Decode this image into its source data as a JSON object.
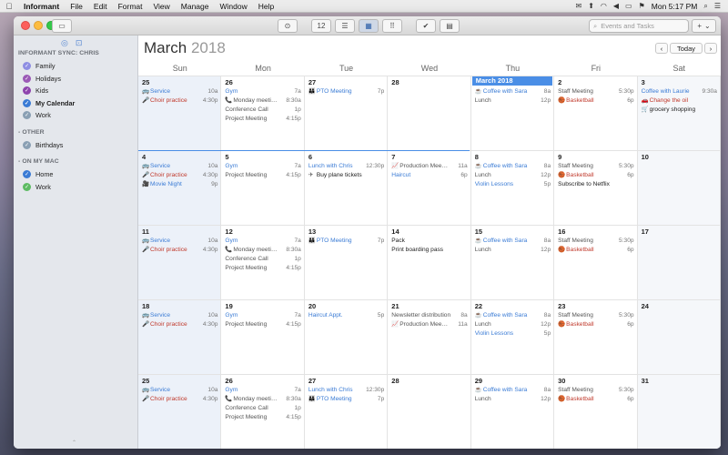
{
  "menubar": {
    "app": "Informant",
    "items": [
      "File",
      "Edit",
      "Format",
      "View",
      "Manage",
      "Window",
      "Help"
    ],
    "clock": "Mon 5:17 PM"
  },
  "toolbar": {
    "search_placeholder": "Events and Tasks",
    "calendar_day_label": "12"
  },
  "sidebar": {
    "sections": [
      {
        "title": "INFORMANT SYNC: CHRIS",
        "items": [
          {
            "label": "Family",
            "color": "#8e8ee3"
          },
          {
            "label": "Holidays",
            "color": "#9b59b6"
          },
          {
            "label": "Kids",
            "color": "#8e44ad"
          },
          {
            "label": "My Calendar",
            "color": "#3a7bd5",
            "bold": true
          },
          {
            "label": "Work",
            "color": "#8aa0b4"
          }
        ]
      },
      {
        "title": "- OTHER",
        "items": [
          {
            "label": "Birthdays",
            "color": "#8aa0b4"
          }
        ]
      },
      {
        "title": "- ON MY MAC",
        "items": [
          {
            "label": "Home",
            "color": "#3a7bd5"
          },
          {
            "label": "Work",
            "color": "#5dbb63"
          }
        ]
      }
    ]
  },
  "calendar": {
    "month": "March",
    "year": "2018",
    "today_label": "Today",
    "banner": "March 2018",
    "days_of_week": [
      "Sun",
      "Mon",
      "Tue",
      "Wed",
      "Thu",
      "Fri",
      "Sat"
    ],
    "weeks": [
      [
        {
          "day": "25",
          "events": [
            {
              "icon": "🚌",
              "name": "Service",
              "time": "10a",
              "style": "blue"
            },
            {
              "icon": "🎤",
              "name": "Choir practice",
              "time": "4:30p",
              "style": "red"
            }
          ]
        },
        {
          "day": "26",
          "events": [
            {
              "name": "Gym",
              "time": "7a",
              "style": "blue"
            },
            {
              "icon": "📞",
              "name": "Monday meeti…",
              "time": "8:30a",
              "style": "plain"
            },
            {
              "name": "Conference Call",
              "time": "1p",
              "style": "plain"
            },
            {
              "name": "Project Meeting",
              "time": "4:15p",
              "style": "plain"
            }
          ]
        },
        {
          "day": "27",
          "events": [
            {
              "icon": "👪",
              "name": "PTO Meeting",
              "time": "7p",
              "style": "blue"
            }
          ]
        },
        {
          "day": "28",
          "events": []
        },
        {
          "day": "1",
          "events": [
            {
              "icon": "☕",
              "name": "Coffee with Sara",
              "time": "8a",
              "style": "blue"
            },
            {
              "name": "Lunch",
              "time": "12p",
              "style": "plain"
            }
          ]
        },
        {
          "day": "2",
          "events": [
            {
              "name": "Staff Meeting",
              "time": "5:30p",
              "style": "plain"
            },
            {
              "icon": "🏀",
              "name": "Basketball",
              "time": "6p",
              "style": "red"
            }
          ]
        },
        {
          "day": "3",
          "events": [
            {
              "name": "Coffee with Laurie",
              "time": "9:30a",
              "style": "blue"
            },
            {
              "icon": "🚗",
              "name": "Change the oil",
              "time": "",
              "style": "red"
            },
            {
              "icon": "🛒",
              "name": "grocery shopping",
              "time": "",
              "style": "dark"
            }
          ]
        }
      ],
      [
        {
          "day": "4",
          "events": [
            {
              "icon": "🚌",
              "name": "Service",
              "time": "10a",
              "style": "blue"
            },
            {
              "icon": "🎤",
              "name": "Choir practice",
              "time": "4:30p",
              "style": "red"
            },
            {
              "icon": "🎥",
              "name": "Movie Night",
              "time": "9p",
              "style": "blue"
            }
          ]
        },
        {
          "day": "5",
          "events": [
            {
              "name": "Gym",
              "time": "7a",
              "style": "blue"
            },
            {
              "name": "Project Meeting",
              "time": "4:15p",
              "style": "plain"
            }
          ]
        },
        {
          "day": "6",
          "events": [
            {
              "name": "Lunch with Chris",
              "time": "12:30p",
              "style": "blue"
            },
            {
              "icon": "✈",
              "name": "Buy plane tickets",
              "time": "",
              "style": "dark"
            }
          ]
        },
        {
          "day": "7",
          "events": [
            {
              "icon": "📈",
              "name": "Production Mee…",
              "time": "11a",
              "style": "plain"
            },
            {
              "name": "Haircut",
              "time": "6p",
              "style": "blue"
            }
          ]
        },
        {
          "day": "8",
          "events": [
            {
              "icon": "☕",
              "name": "Coffee with Sara",
              "time": "8a",
              "style": "blue"
            },
            {
              "name": "Lunch",
              "time": "12p",
              "style": "plain"
            },
            {
              "name": "Violin Lessons",
              "time": "5p",
              "style": "blue"
            }
          ]
        },
        {
          "day": "9",
          "events": [
            {
              "name": "Staff Meeting",
              "time": "5:30p",
              "style": "plain"
            },
            {
              "icon": "🏀",
              "name": "Basketball",
              "time": "6p",
              "style": "red"
            },
            {
              "name": "Subscribe to Netflix",
              "time": "",
              "style": "dark"
            }
          ]
        },
        {
          "day": "10",
          "events": []
        }
      ],
      [
        {
          "day": "11",
          "events": [
            {
              "icon": "🚌",
              "name": "Service",
              "time": "10a",
              "style": "blue"
            },
            {
              "icon": "🎤",
              "name": "Choir practice",
              "time": "4:30p",
              "style": "red"
            }
          ]
        },
        {
          "day": "12",
          "events": [
            {
              "name": "Gym",
              "time": "7a",
              "style": "blue"
            },
            {
              "icon": "📞",
              "name": "Monday meeti…",
              "time": "8:30a",
              "style": "plain"
            },
            {
              "name": "Conference Call",
              "time": "1p",
              "style": "plain"
            },
            {
              "name": "Project Meeting",
              "time": "4:15p",
              "style": "plain"
            }
          ]
        },
        {
          "day": "13",
          "events": [
            {
              "icon": "👪",
              "name": "PTO Meeting",
              "time": "7p",
              "style": "blue"
            }
          ]
        },
        {
          "day": "14",
          "events": [
            {
              "name": "Pack",
              "time": "",
              "style": "dark"
            },
            {
              "name": "Print boarding pass",
              "time": "",
              "style": "dark"
            }
          ]
        },
        {
          "day": "15",
          "events": [
            {
              "icon": "☕",
              "name": "Coffee with Sara",
              "time": "8a",
              "style": "blue"
            },
            {
              "name": "Lunch",
              "time": "12p",
              "style": "plain"
            }
          ]
        },
        {
          "day": "16",
          "events": [
            {
              "name": "Staff Meeting",
              "time": "5:30p",
              "style": "plain"
            },
            {
              "icon": "🏀",
              "name": "Basketball",
              "time": "6p",
              "style": "red"
            }
          ]
        },
        {
          "day": "17",
          "events": []
        }
      ],
      [
        {
          "day": "18",
          "events": [
            {
              "icon": "🚌",
              "name": "Service",
              "time": "10a",
              "style": "blue"
            },
            {
              "icon": "🎤",
              "name": "Choir practice",
              "time": "4:30p",
              "style": "red"
            }
          ]
        },
        {
          "day": "19",
          "events": [
            {
              "name": "Gym",
              "time": "7a",
              "style": "blue"
            },
            {
              "name": "Project Meeting",
              "time": "4:15p",
              "style": "plain"
            }
          ]
        },
        {
          "day": "20",
          "events": [
            {
              "name": "Haircut Appt.",
              "time": "5p",
              "style": "blue"
            }
          ]
        },
        {
          "day": "21",
          "events": [
            {
              "name": "Newsletter distribution",
              "time": "8a",
              "style": "plain"
            },
            {
              "icon": "📈",
              "name": "Production Mee…",
              "time": "11a",
              "style": "plain"
            }
          ]
        },
        {
          "day": "22",
          "events": [
            {
              "icon": "☕",
              "name": "Coffee with Sara",
              "time": "8a",
              "style": "blue"
            },
            {
              "name": "Lunch",
              "time": "12p",
              "style": "plain"
            },
            {
              "name": "Violin Lessons",
              "time": "5p",
              "style": "blue"
            }
          ]
        },
        {
          "day": "23",
          "events": [
            {
              "name": "Staff Meeting",
              "time": "5:30p",
              "style": "plain"
            },
            {
              "icon": "🏀",
              "name": "Basketball",
              "time": "6p",
              "style": "red"
            }
          ]
        },
        {
          "day": "24",
          "events": []
        }
      ],
      [
        {
          "day": "25",
          "events": [
            {
              "icon": "🚌",
              "name": "Service",
              "time": "10a",
              "style": "blue"
            },
            {
              "icon": "🎤",
              "name": "Choir practice",
              "time": "4:30p",
              "style": "red"
            }
          ]
        },
        {
          "day": "26",
          "events": [
            {
              "name": "Gym",
              "time": "7a",
              "style": "blue"
            },
            {
              "icon": "📞",
              "name": "Monday meeti…",
              "time": "8:30a",
              "style": "plain"
            },
            {
              "name": "Conference Call",
              "time": "1p",
              "style": "plain"
            },
            {
              "name": "Project Meeting",
              "time": "4:15p",
              "style": "plain"
            }
          ]
        },
        {
          "day": "27",
          "events": [
            {
              "name": "Lunch with Chris",
              "time": "12:30p",
              "style": "blue"
            },
            {
              "icon": "👪",
              "name": "PTO Meeting",
              "time": "7p",
              "style": "blue"
            }
          ]
        },
        {
          "day": "28",
          "events": []
        },
        {
          "day": "29",
          "events": [
            {
              "icon": "☕",
              "name": "Coffee with Sara",
              "time": "8a",
              "style": "blue"
            },
            {
              "name": "Lunch",
              "time": "12p",
              "style": "plain"
            }
          ]
        },
        {
          "day": "30",
          "events": [
            {
              "name": "Staff Meeting",
              "time": "5:30p",
              "style": "plain"
            },
            {
              "icon": "🏀",
              "name": "Basketball",
              "time": "6p",
              "style": "red"
            }
          ]
        },
        {
          "day": "31",
          "events": []
        }
      ]
    ]
  }
}
